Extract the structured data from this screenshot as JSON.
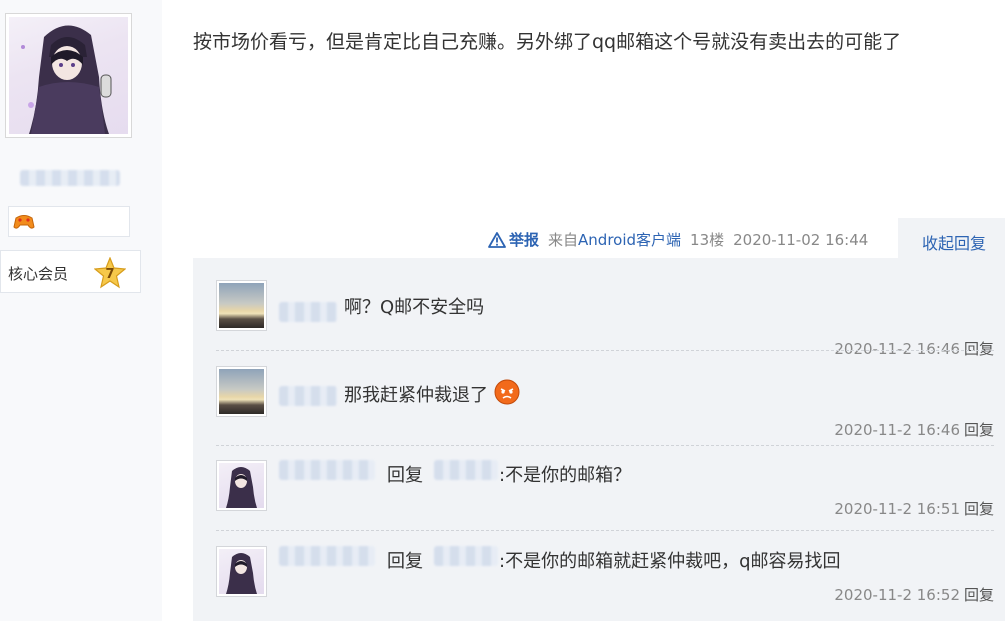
{
  "post": {
    "content": "按市场价看亏，但是肯定比自己充赚。另外绑了qq邮箱这个号就没有卖出去的可能了",
    "report_label": "举报",
    "client_prefix": "来自",
    "client_name": "Android客户端",
    "floor": "13楼",
    "datetime": "2020-11-02 16:44",
    "fold_label": "收起回复"
  },
  "author": {
    "member_label": "核心会员",
    "level": "7"
  },
  "replies": [
    {
      "text": "啊？Q邮不安全吗",
      "time": "2020-11-2 16:46",
      "reply_label": "回复",
      "avatar": "sunset-avatar-icon"
    },
    {
      "text": "那我赶紧仲裁退了",
      "time": "2020-11-2 16:46",
      "reply_label": "回复",
      "avatar": "sunset-avatar-icon"
    },
    {
      "prefix": "回复",
      "text": ":不是你的邮箱？",
      "time": "2020-11-2 16:51",
      "reply_label": "回复",
      "avatar": "hooded-girl-avatar-icon"
    },
    {
      "prefix": "回复",
      "text": ":不是你的邮箱就赶紧仲裁吧，q邮容易找回",
      "time": "2020-11-2 16:52",
      "reply_label": "回复",
      "avatar": "hooded-girl-avatar-icon"
    }
  ],
  "colors": {
    "link": "#2d64b3",
    "meta": "#888888",
    "panel": "#f1f3f6"
  }
}
